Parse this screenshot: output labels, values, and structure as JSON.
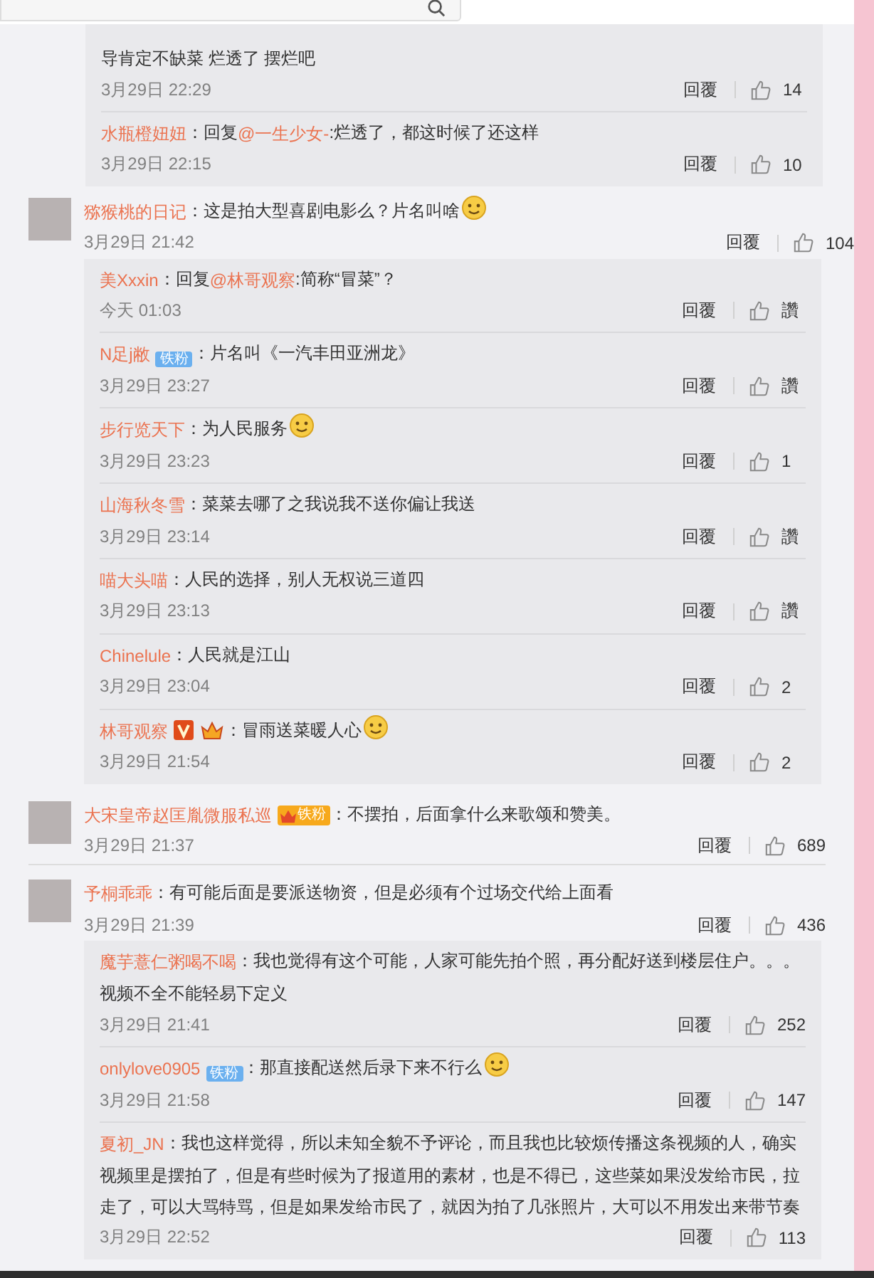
{
  "orphan_replies": [
    {
      "text": "导肯定不缺菜 烂透了 摆烂吧",
      "emoji": false,
      "time": "3月29日 22:29",
      "reply_label": "回覆",
      "likes": "14"
    },
    {
      "name": "水瓶橙妞妞",
      "prefix": "：回复",
      "mention": "@一生少女-",
      "text": ":烂透了，都这时候了还这样",
      "emoji": false,
      "time": "3月29日 22:15",
      "reply_label": "回覆",
      "likes": "10"
    }
  ],
  "comments": [
    {
      "name": "猕猴桃的日记",
      "text": "：这是拍大型喜剧电影么？片名叫啥",
      "emoji": true,
      "time": "3月29日 21:42",
      "reply_label": "回覆",
      "likes": "104",
      "replies": [
        {
          "name": "美Xxxin",
          "prefix": "：回复",
          "mention": "@林哥观察",
          "text": ":简称“冒菜”？",
          "emoji": false,
          "time": "今天 01:03",
          "reply_label": "回覆",
          "likes": "讚"
        },
        {
          "name": "N足j敝",
          "badges": [
            {
              "kind": "fan",
              "label": "铁粉"
            }
          ],
          "text": "：片名叫《一汽丰田亚洲龙》",
          "emoji": false,
          "time": "3月29日 23:27",
          "reply_label": "回覆",
          "likes": "讚"
        },
        {
          "name": "步行览天下",
          "text": "：为人民服务",
          "emoji": true,
          "time": "3月29日 23:23",
          "reply_label": "回覆",
          "likes": "1"
        },
        {
          "name": "山海秋冬雪",
          "text": "：菜菜去哪了之我说我不送你偏让我送",
          "emoji": false,
          "time": "3月29日 23:14",
          "reply_label": "回覆",
          "likes": "讚"
        },
        {
          "name": "喵大头喵",
          "text": "：人民的选择，别人无权说三道四",
          "emoji": false,
          "time": "3月29日 23:13",
          "reply_label": "回覆",
          "likes": "讚"
        },
        {
          "name": "Chinelule",
          "text": "：人民就是江山",
          "emoji": false,
          "time": "3月29日 23:04",
          "reply_label": "回覆",
          "likes": "2"
        },
        {
          "name": "林哥观察",
          "badges": [
            {
              "kind": "verified"
            },
            {
              "kind": "crown"
            }
          ],
          "text": "：冒雨送菜暖人心",
          "emoji": true,
          "time": "3月29日 21:54",
          "reply_label": "回覆",
          "likes": "2"
        }
      ]
    },
    {
      "name": "大宋皇帝赵匡胤微服私巡",
      "badges": [
        {
          "kind": "crown-fan",
          "label": "铁粉"
        }
      ],
      "text": "：不摆拍，后面拿什么来歌颂和赞美。",
      "emoji": false,
      "time": "3月29日 21:37",
      "reply_label": "回覆",
      "likes": "689"
    },
    {
      "name": "予桐乖乖",
      "text": "：有可能后面是要派送物资，但是必须有个过场交代给上面看",
      "emoji": false,
      "time": "3月29日 21:39",
      "reply_label": "回覆",
      "likes": "436",
      "replies": [
        {
          "name": "魔芋薏仁粥喝不喝",
          "text": "：我也觉得有这个可能，人家可能先拍个照，再分配好送到楼层住户。。。视频不全不能轻易下定义",
          "emoji": false,
          "time": "3月29日 21:41",
          "reply_label": "回覆",
          "likes": "252"
        },
        {
          "name": "onlylove0905",
          "badges": [
            {
              "kind": "fan",
              "label": "铁粉"
            }
          ],
          "text": "：那直接配送然后录下来不行么",
          "emoji": true,
          "time": "3月29日 21:58",
          "reply_label": "回覆",
          "likes": "147"
        },
        {
          "name": "夏初_JN",
          "text": "：我也这样觉得，所以未知全貌不予评论，而且我也比较烦传播这条视频的人，确实视频里是摆拍了，但是有些时候为了报道用的素材，也是不得已，这些菜如果没发给市民，拉走了，可以大骂特骂，但是如果发给市民了，就因为拍了几张照片，大可以不用发出来带节奏",
          "emoji": false,
          "time": "3月29日 22:52",
          "reply_label": "回覆",
          "likes": "113"
        }
      ]
    }
  ]
}
